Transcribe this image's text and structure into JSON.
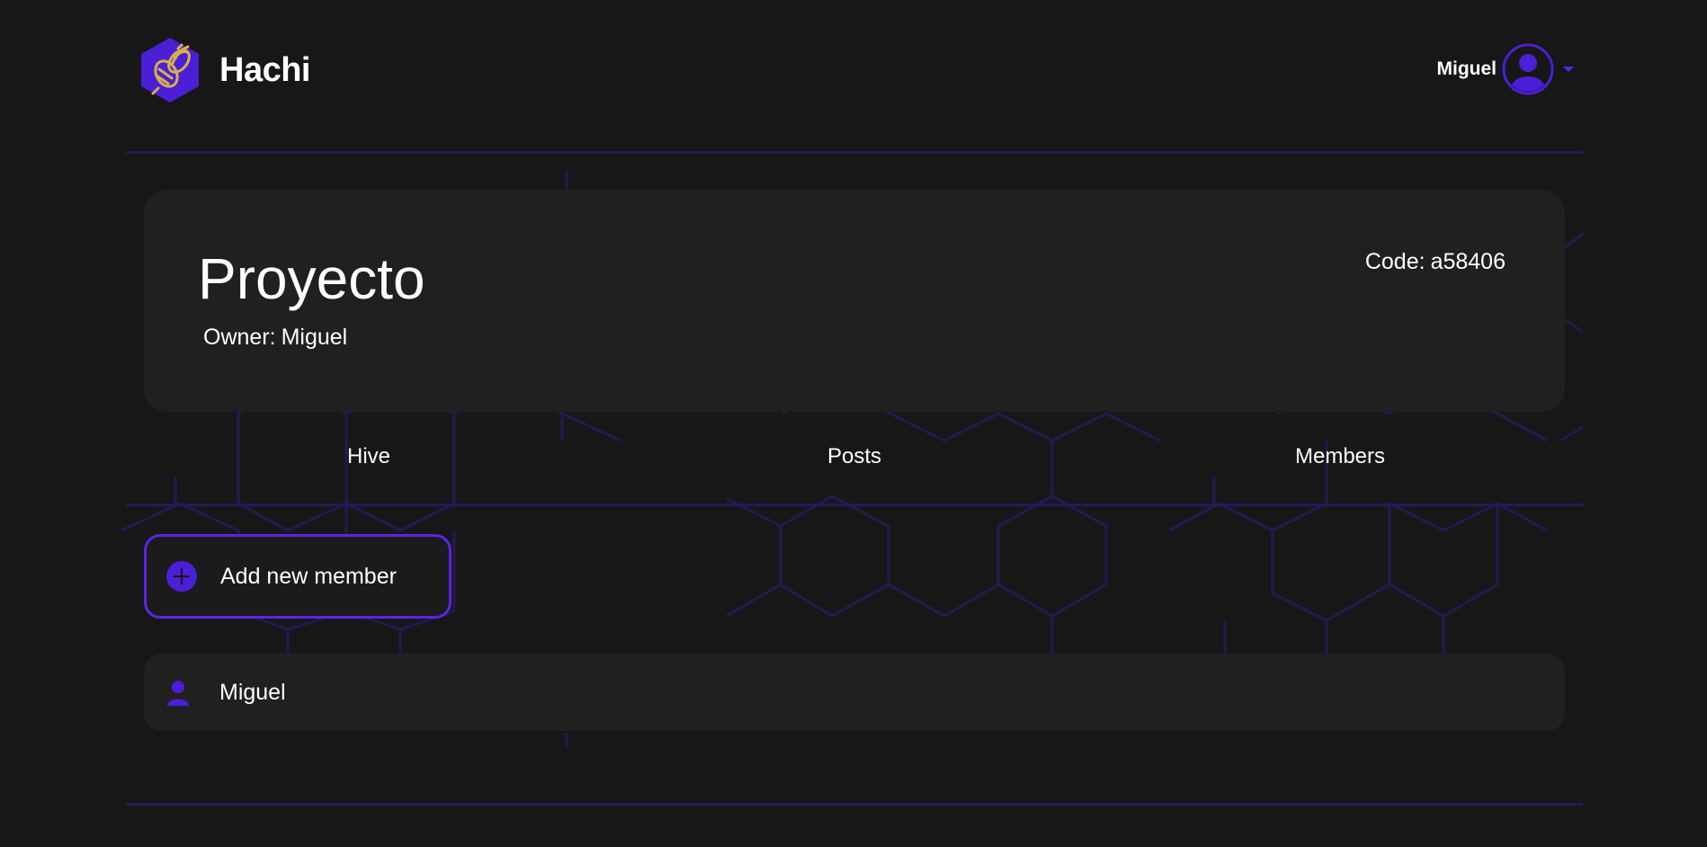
{
  "header": {
    "brand_name": "Hachi",
    "user_name": "Miguel"
  },
  "project": {
    "title": "Proyecto",
    "owner_label": "Owner:",
    "owner_name": "Miguel",
    "code_label": "Code:",
    "code_value": "a58406"
  },
  "tabs": [
    {
      "label": "Hive"
    },
    {
      "label": "Posts"
    },
    {
      "label": "Members"
    }
  ],
  "actions": {
    "add_member_label": "Add new member"
  },
  "members": [
    {
      "name": "Miguel"
    }
  ],
  "icons": {
    "logo": "bee-hexagon-logo",
    "avatar": "user-avatar-icon",
    "dropdown": "caret-down-icon",
    "add": "plus-circle-icon",
    "member": "person-icon"
  },
  "colors": {
    "background": "#171717",
    "card": "#202020",
    "accent": "#5a25e8",
    "honeycomb_lines": "#231a52",
    "logo_bee": "#d9b04a"
  }
}
